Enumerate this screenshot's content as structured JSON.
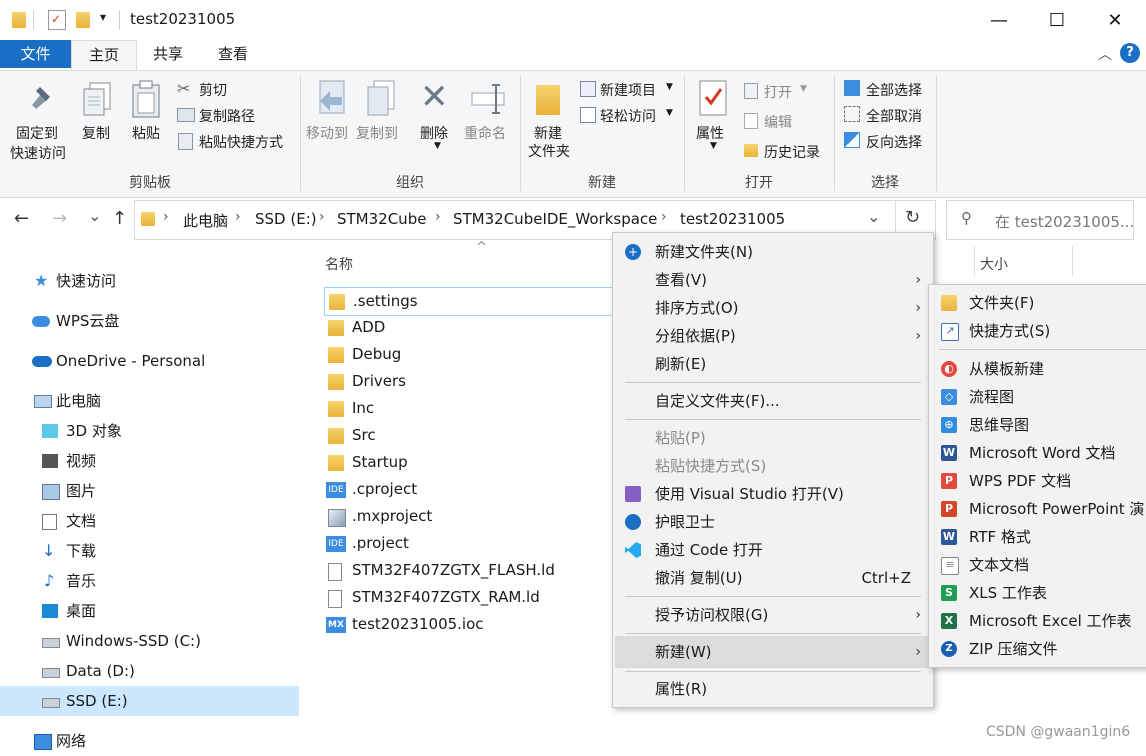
{
  "window": {
    "title": "test20231005",
    "quick_access_dropdown": "▾",
    "minimize": "—",
    "maximize": "☐",
    "close": "✕"
  },
  "ribbon_tabs": [
    "文件",
    "主页",
    "共享",
    "查看"
  ],
  "ribbon_collapse": "︿",
  "help": "?",
  "ribbon": {
    "clipboard": {
      "label": "剪贴板",
      "pin": [
        "固定到",
        "快速访问"
      ],
      "copy": "复制",
      "paste": "粘贴",
      "cut": "剪切",
      "copy_path": "复制路径",
      "paste_shortcut": "粘贴快捷方式"
    },
    "organize": {
      "label": "组织",
      "move_to": "移动到",
      "copy_to": "复制到",
      "delete": "删除",
      "rename": "重命名"
    },
    "new": {
      "label": "新建",
      "new_folder": [
        "新建",
        "文件夹"
      ],
      "new_item": "新建项目",
      "easy_access": "轻松访问"
    },
    "open": {
      "label": "打开",
      "properties": "属性",
      "open": "打开",
      "edit": "编辑",
      "history": "历史记录"
    },
    "select": {
      "label": "选择",
      "select_all": "全部选择",
      "select_none": "全部取消",
      "invert": "反向选择"
    }
  },
  "nav": {
    "back": "←",
    "forward": "→",
    "recent": "⌄",
    "up": "↑",
    "breadcrumb": [
      "此电脑",
      "SSD (E:)",
      "STM32Cube",
      "STM32CubeIDE_Workspace",
      "test20231005"
    ],
    "breadcrumb_sep": "›",
    "dropdown": "⌄",
    "refresh": "↻",
    "search_placeholder": "在 test20231005..."
  },
  "columns": {
    "name": "名称",
    "size": "大小",
    "sort_arrow": "^"
  },
  "sidebar": [
    {
      "label": "快速访问",
      "icon": "star-icon"
    },
    {
      "label": "WPS云盘",
      "icon": "cloud-icon"
    },
    {
      "label": "OneDrive - Personal",
      "icon": "onedrive-icon"
    },
    {
      "label": "此电脑",
      "icon": "computer-icon"
    },
    {
      "label": "3D 对象",
      "icon": "cube-icon"
    },
    {
      "label": "视频",
      "icon": "video-icon"
    },
    {
      "label": "图片",
      "icon": "picture-icon"
    },
    {
      "label": "文档",
      "icon": "document-icon"
    },
    {
      "label": "下载",
      "icon": "download-icon"
    },
    {
      "label": "音乐",
      "icon": "music-icon"
    },
    {
      "label": "桌面",
      "icon": "desktop-icon"
    },
    {
      "label": "Windows-SSD (C:)",
      "icon": "drive-icon"
    },
    {
      "label": "Data (D:)",
      "icon": "drive-icon"
    },
    {
      "label": "SSD (E:)",
      "icon": "drive-icon",
      "selected": true
    },
    {
      "label": "网络",
      "icon": "network-icon"
    }
  ],
  "files": [
    {
      "name": ".settings",
      "type": "folder"
    },
    {
      "name": "ADD",
      "type": "folder"
    },
    {
      "name": "Debug",
      "type": "folder"
    },
    {
      "name": "Drivers",
      "type": "folder"
    },
    {
      "name": "Inc",
      "type": "folder"
    },
    {
      "name": "Src",
      "type": "folder"
    },
    {
      "name": "Startup",
      "type": "folder"
    },
    {
      "name": ".cproject",
      "type": "ide",
      "badge": "IDE"
    },
    {
      "name": ".mxproject",
      "type": "mx"
    },
    {
      "name": ".project",
      "type": "ide",
      "badge": "IDE"
    },
    {
      "name": "STM32F407ZGTX_FLASH.ld",
      "type": "file"
    },
    {
      "name": "STM32F407ZGTX_RAM.ld",
      "type": "file"
    },
    {
      "name": "test20231005.ioc",
      "type": "ioc",
      "badge": "MX"
    }
  ],
  "context_menu": {
    "items": [
      {
        "label": "新建文件夹(N)"
      },
      {
        "label": "查看(V)",
        "submenu": true
      },
      {
        "label": "排序方式(O)",
        "submenu": true
      },
      {
        "label": "分组依据(P)",
        "submenu": true
      },
      {
        "label": "刷新(E)"
      },
      {
        "label": "自定义文件夹(F)..."
      },
      {
        "label": "粘贴(P)",
        "disabled": true
      },
      {
        "label": "粘贴快捷方式(S)",
        "disabled": true
      },
      {
        "label": "使用 Visual Studio 打开(V)"
      },
      {
        "label": "护眼卫士"
      },
      {
        "label": "通过 Code 打开"
      },
      {
        "label": "撤消 复制(U)",
        "shortcut": "Ctrl+Z"
      },
      {
        "label": "授予访问权限(G)",
        "submenu": true
      },
      {
        "label": "新建(W)",
        "submenu": true,
        "highlighted": true
      },
      {
        "label": "属性(R)"
      }
    ],
    "arrow": "›"
  },
  "new_submenu": [
    {
      "label": "文件夹(F)",
      "color": "#e8b33a",
      "glyph": ""
    },
    {
      "label": "快捷方式(S)",
      "color": "#3b6fb6",
      "glyph": "↗"
    },
    {
      "label": "从模板新建",
      "color": "#e04a3f",
      "glyph": "◐"
    },
    {
      "label": "流程图",
      "color": "#3c8de0",
      "glyph": "◇"
    },
    {
      "label": "思维导图",
      "color": "#2f8de0",
      "glyph": "⊕"
    },
    {
      "label": "Microsoft Word 文档",
      "color": "#2b5797",
      "glyph": "W"
    },
    {
      "label": "WPS PDF 文档",
      "color": "#e04a3f",
      "glyph": "P"
    },
    {
      "label": "Microsoft PowerPoint 演",
      "color": "#d24726",
      "glyph": "P"
    },
    {
      "label": "RTF 格式",
      "color": "#2b5797",
      "glyph": "W"
    },
    {
      "label": "文本文档",
      "color": "#888888",
      "glyph": "≡"
    },
    {
      "label": "XLS 工作表",
      "color": "#1f9d55",
      "glyph": "S"
    },
    {
      "label": "Microsoft Excel 工作表",
      "color": "#217346",
      "glyph": "X"
    },
    {
      "label": "ZIP 压缩文件",
      "color": "#1a5fb4",
      "glyph": "Z"
    }
  ],
  "watermark": "CSDN @gwaan1gin6",
  "colors": {
    "accent": "#1a6fc4",
    "selection": "#cce8ff",
    "menu_hover": "#dcdcdc"
  }
}
